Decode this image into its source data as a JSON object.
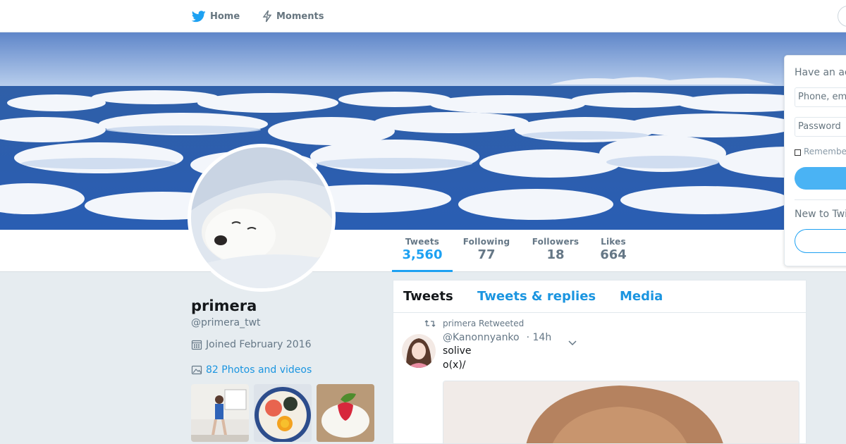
{
  "nav": {
    "home_label": "Home",
    "moments_label": "Moments"
  },
  "profile": {
    "name": "primera",
    "handle": "@primera_twt",
    "joined": "Joined February 2016",
    "photos_link": "82 Photos and videos"
  },
  "stats": [
    {
      "label": "Tweets",
      "value": "3,560",
      "active": true
    },
    {
      "label": "Following",
      "value": "77",
      "active": false
    },
    {
      "label": "Followers",
      "value": "18",
      "active": false
    },
    {
      "label": "Likes",
      "value": "664",
      "active": false
    }
  ],
  "timeline": {
    "tabs": [
      "Tweets",
      "Tweets & replies",
      "Media"
    ],
    "tweet": {
      "retweet_context": "primera Retweeted",
      "author_handle": "@Kanonnyanko",
      "time": "· 14h",
      "line1": "solive",
      "line2": "o(x)/"
    }
  },
  "login": {
    "title": "Have an ac",
    "phone_placeholder": "Phone, em",
    "password_placeholder": "Password",
    "remember": "Remembe",
    "new_to": "New to Twi"
  },
  "colors": {
    "accent": "#1da1f2",
    "link": "#1b95e0",
    "background": "#e6ecf0"
  }
}
